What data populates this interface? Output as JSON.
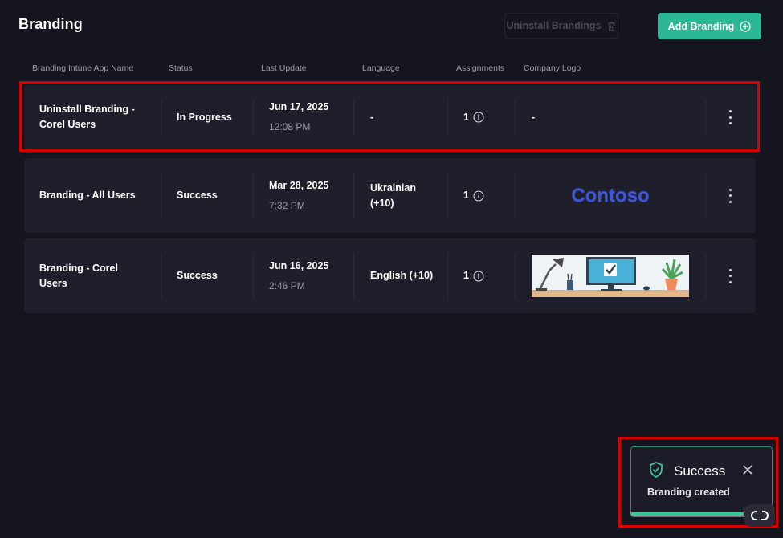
{
  "header": {
    "title": "Branding",
    "uninstall_label": "Uninstall Brandings",
    "add_label": "Add Branding"
  },
  "table": {
    "columns": [
      "Branding Intune App Name",
      "Status",
      "Last Update",
      "Language",
      "Assignments",
      "Company Logo"
    ],
    "rows": [
      {
        "name_line1": "Uninstall Branding -",
        "name_line2": "Corel Users",
        "status": "In Progress",
        "date": "Jun 17, 2025",
        "time": "12:08 PM",
        "language_line1": "-",
        "language_line2": "",
        "assignments": "1",
        "logo_text": "-",
        "logo_type": "none"
      },
      {
        "name_line1": "Branding - All Users",
        "name_line2": "",
        "status": "Success",
        "date": "Mar 28, 2025",
        "time": "7:32 PM",
        "language_line1": "Ukrainian",
        "language_line2": "(+10)",
        "assignments": "1",
        "logo_text": "Contoso",
        "logo_type": "text"
      },
      {
        "name_line1": "Branding - Corel",
        "name_line2": "Users",
        "status": "Success",
        "date": "Jun 16, 2025",
        "time": "2:46 PM",
        "language_line1": "English (+10)",
        "language_line2": "",
        "assignments": "1",
        "logo_text": "",
        "logo_type": "desk-illustration"
      }
    ]
  },
  "toast": {
    "title": "Success",
    "message": "Branding created",
    "icon": "shield-check-icon",
    "progress": 0.8
  },
  "colors": {
    "background": "#15151f",
    "row": "#1f1f2c",
    "accent": "#2bb894",
    "highlight": "#d90000",
    "logo_blue": "#3f55d3"
  }
}
